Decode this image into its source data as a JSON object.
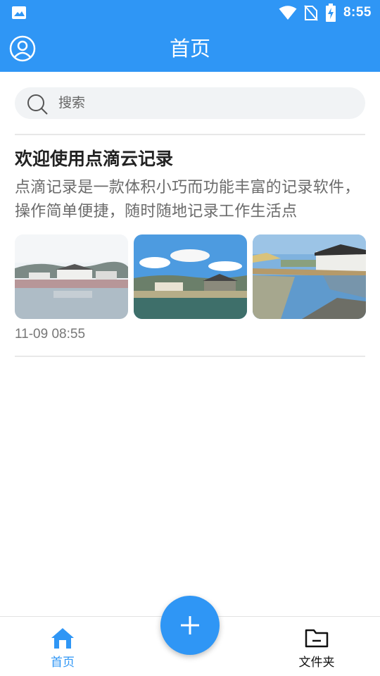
{
  "status_bar": {
    "time": "8:55",
    "icons": [
      "image-icon",
      "wifi-icon",
      "no-sim-icon",
      "battery-charging-icon"
    ]
  },
  "app_bar": {
    "title": "首页",
    "profile_icon": "account-circle-icon"
  },
  "search": {
    "placeholder": "搜索",
    "icon": "search-icon"
  },
  "note": {
    "title": "欢迎使用点滴云记录",
    "body": "点滴记录是一款体积小巧而功能丰富的记录软件，操作简单便捷，随时随地记录工作生活点",
    "time": "11-09 08:55",
    "images": [
      "village-lake-photo",
      "village-sky-photo",
      "village-reflection-photo"
    ]
  },
  "bottom_nav": {
    "items": [
      {
        "label": "首页",
        "icon": "home-icon",
        "active": true
      },
      {
        "label": "文件夹",
        "icon": "folder-icon",
        "active": false
      }
    ],
    "fab_icon": "plus-icon"
  },
  "colors": {
    "primary": "#2f96f5",
    "search_bg": "#f1f3f5",
    "divider": "#e8e8e8"
  }
}
